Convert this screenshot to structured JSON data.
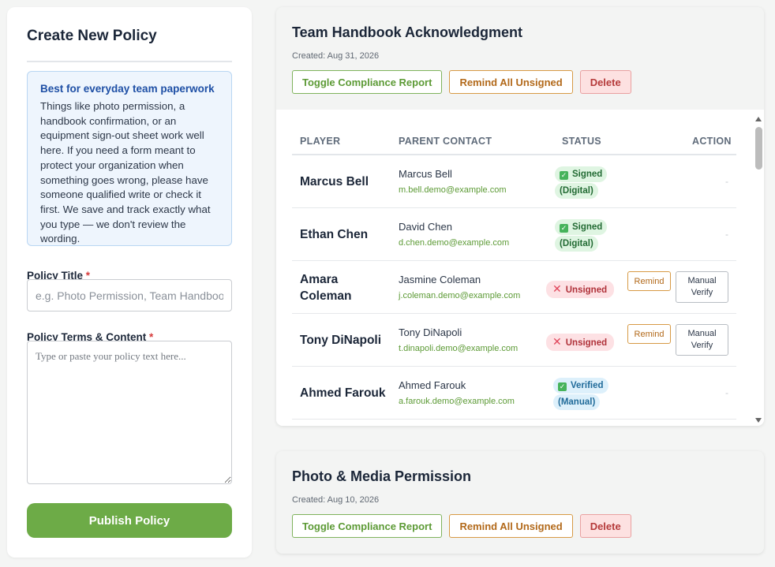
{
  "form": {
    "title": "Create New Policy",
    "info_heading": "Best for everyday team paperwork",
    "info_body": "Things like photo permission, a handbook confirmation, or an equipment sign-out sheet work well here. If you need a form meant to protect your organization when something goes wrong, please have someone qualified write or check it first. We save and track exactly what you type — we don't review the wording.",
    "policy_title_label": "Policy Title",
    "policy_title_placeholder": "e.g. Photo Permission, Team Handbook",
    "policy_title_value": "",
    "content_label": "Policy Terms & Content",
    "content_placeholder": "Type or paste your policy text here...",
    "content_value": "",
    "required_mark": "*",
    "publish_label": "Publish Policy"
  },
  "policies": [
    {
      "title": "Team Handbook Acknowledgment",
      "created": "Created: Aug 31, 2026",
      "toggle_label": "Toggle Compliance Report",
      "remind_all_label": "Remind All Unsigned",
      "delete_label": "Delete",
      "table": {
        "headers": [
          "PLAYER",
          "PARENT CONTACT",
          "STATUS",
          "ACTION"
        ],
        "rows": [
          {
            "player": "Marcus Bell",
            "parent": "Marcus Bell",
            "email": "m.bell.demo@example.com",
            "status": "signed",
            "status_line1": "Signed",
            "status_line2": "(Digital)",
            "action": "-"
          },
          {
            "player": "Ethan Chen",
            "parent": "David Chen",
            "email": "d.chen.demo@example.com",
            "status": "signed",
            "status_line1": "Signed",
            "status_line2": "(Digital)",
            "action": "-"
          },
          {
            "player": "Amara Coleman",
            "parent": "Jasmine Coleman",
            "email": "j.coleman.demo@example.com",
            "status": "unsigned",
            "status_line1": "Unsigned",
            "remind_label": "Remind",
            "verify_label": "Manual Verify"
          },
          {
            "player": "Tony DiNapoli",
            "parent": "Tony DiNapoli",
            "email": "t.dinapoli.demo@example.com",
            "status": "unsigned",
            "status_line1": "Unsigned",
            "remind_label": "Remind",
            "verify_label": "Manual Verify"
          },
          {
            "player": "Ahmed Farouk",
            "parent": "Ahmed Farouk",
            "email": "a.farouk.demo@example.com",
            "status": "verified",
            "status_line1": "Verified",
            "status_line2": "(Manual)",
            "action": "-"
          }
        ]
      }
    },
    {
      "title": "Photo & Media Permission",
      "created": "Created: Aug 10, 2026",
      "toggle_label": "Toggle Compliance Report",
      "remind_all_label": "Remind All Unsigned",
      "delete_label": "Delete"
    }
  ],
  "colors": {
    "accent_green": "#6dab47",
    "signed_bg": "#dff5e2",
    "unsigned_bg": "#fde1e4",
    "verified_bg": "#ddf0fb",
    "delete_bg": "#fde1e1"
  }
}
